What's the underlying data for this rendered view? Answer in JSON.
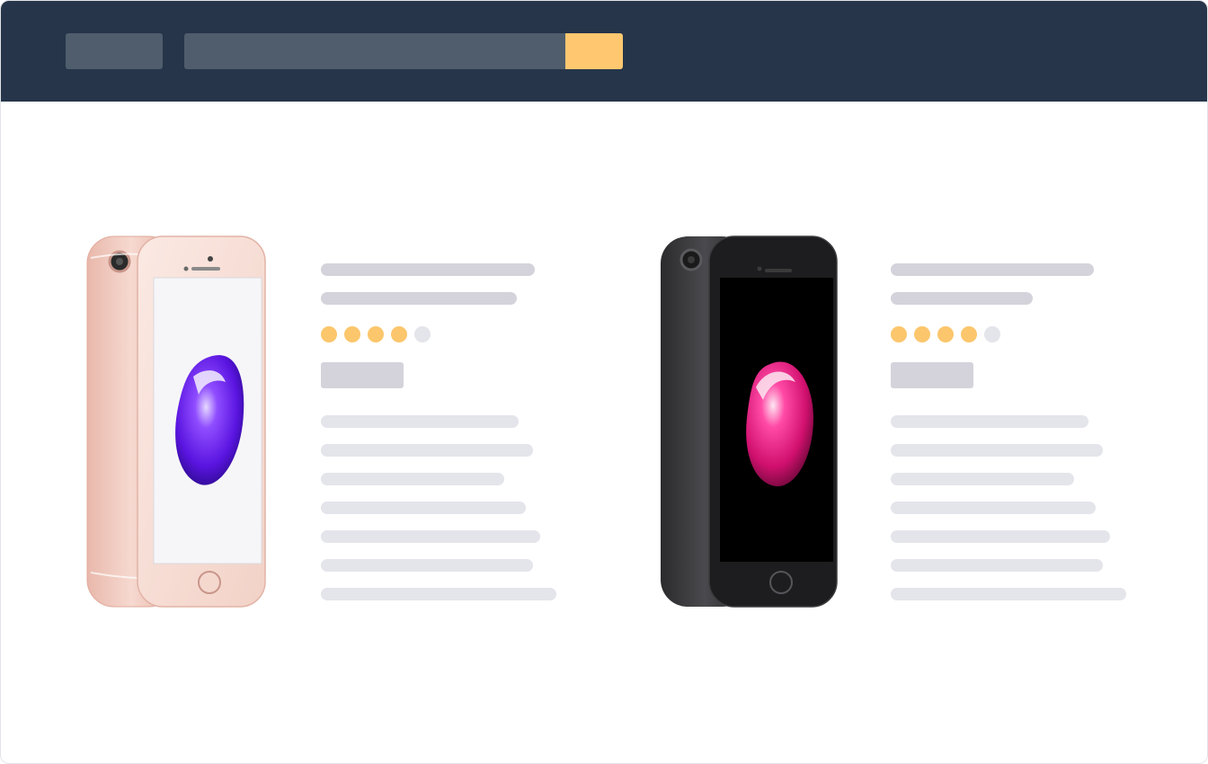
{
  "header": {
    "logo_placeholder": "logo-placeholder",
    "search": {
      "placeholder": "",
      "value": "",
      "button_icon": "search-icon"
    }
  },
  "colors": {
    "topbar": "#26354a",
    "placeholder_dark": "#4f5d6d",
    "accent": "#ffc870",
    "star_on": "#fbc66c",
    "star_off": "#e4e4eb",
    "text_placeholder": "#d4d3db",
    "desc_placeholder": "#e4e4eb"
  },
  "products": [
    {
      "image": "rose-gold-phone-image",
      "rating": 4,
      "rating_max": 5,
      "name_placeholder": true,
      "price_placeholder": true
    },
    {
      "image": "black-phone-image",
      "rating": 4,
      "rating_max": 5,
      "name_placeholder": true,
      "price_placeholder": true
    }
  ]
}
